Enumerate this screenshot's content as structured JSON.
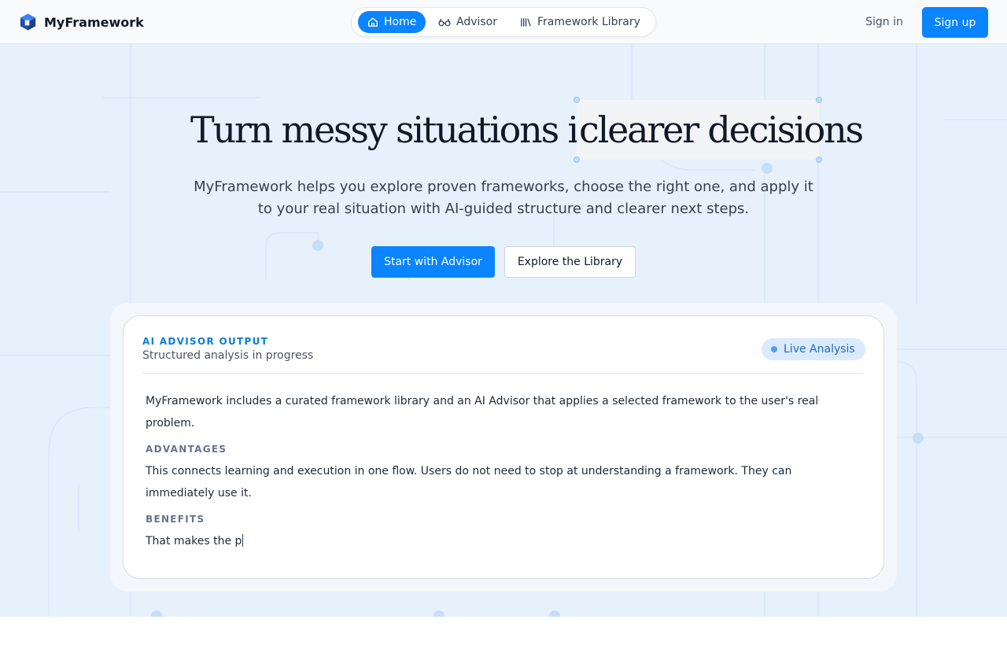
{
  "header": {
    "brand_name": "MyFramework",
    "nav": {
      "home_label": "Home",
      "advisor_label": "Advisor",
      "library_label": "Framework Library"
    },
    "signin_label": "Sign in",
    "signup_label": "Sign up"
  },
  "hero": {
    "headline_start": "Turn messy situations into",
    "headline_highlight": "clearer decisions",
    "subtitle": "MyFramework helps you explore proven frameworks, choose the right one, and apply it to your real situation with AI-guided structure and clearer next steps.",
    "cta_primary": "Start with Advisor",
    "cta_secondary": "Explore the Library"
  },
  "output_card": {
    "eyebrow": "AI ADVISOR OUTPUT",
    "subtitle": "Structured analysis in progress",
    "badge": "Live Analysis",
    "intro": "MyFramework includes a curated framework library and an AI Advisor that applies a selected framework to the user's real problem.",
    "sections": {
      "advantages": {
        "label": "ADVANTAGES",
        "text": "This connects learning and execution in one flow. Users do not need to stop at understanding a framework. They can immediately use it."
      },
      "benefits": {
        "label": "BENEFITS",
        "text": "That makes the p"
      }
    }
  },
  "colors": {
    "accent": "#0a84ff",
    "hero_background": "#e6f1fc",
    "eyebrow": "#0a7fd6",
    "badge_background": "#dbeafe"
  },
  "icons": {
    "brand": "cube-logo-icon",
    "home": "home-icon",
    "advisor": "glasses-icon",
    "library": "books-icon",
    "live": "status-dot-icon"
  }
}
